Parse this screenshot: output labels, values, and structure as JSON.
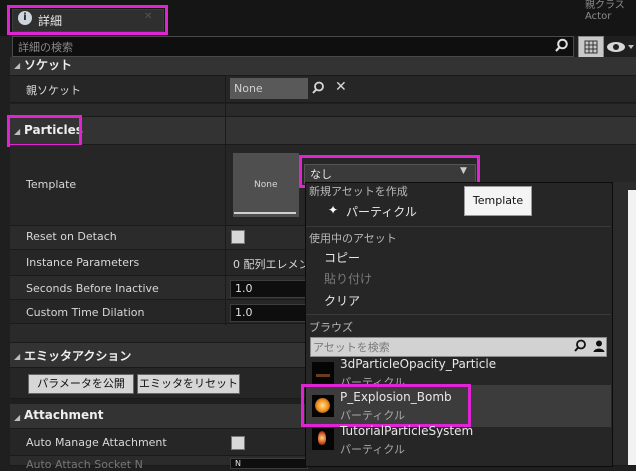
{
  "header": {
    "tab_title": "詳細",
    "top_right_text": "親クラス Actor"
  },
  "search": {
    "placeholder": "詳細の検索"
  },
  "categories": {
    "socket": "ソケット",
    "particles": "Particles",
    "emitter_actions": "エミッタアクション",
    "attachment": "Attachment"
  },
  "properties": {
    "parent_socket": {
      "label": "親ソケット",
      "value": "None"
    },
    "template": {
      "label": "Template",
      "thumb_label": "None",
      "dropdown_value": "なし"
    },
    "reset_on_detach": {
      "label": "Reset on Detach"
    },
    "instance_parameters": {
      "label": "Instance Parameters",
      "value": "0 配列エレメン"
    },
    "seconds_before_inactive": {
      "label": "Seconds Before Inactive",
      "value": "1.0"
    },
    "custom_time_dilation": {
      "label": "Custom Time Dilation",
      "value": "1.0"
    },
    "auto_manage_attachment": {
      "label": "Auto Manage Attachment"
    },
    "auto_attach_cutoff": {
      "label": "Auto Attach Socket N",
      "value": "N"
    }
  },
  "emitter_buttons": {
    "publish": "パラメータを公開",
    "reset": "エミッタをリセット"
  },
  "menu": {
    "create_header": "新規アセットを作成",
    "create_item": "パーティクル",
    "current_header": "使用中のアセット",
    "copy": "コピー",
    "paste": "貼り付け",
    "clear": "クリア",
    "browse_header": "ブラウズ",
    "search_placeholder": "アセットを検索",
    "assets": [
      {
        "name": "3dParticleOpacity_Particle",
        "type": "パーティクル"
      },
      {
        "name": "P_Explosion_Bomb",
        "type": "パーティクル"
      },
      {
        "name": "TutorialParticleSystem",
        "type": "パーティクル"
      }
    ]
  },
  "tooltip": {
    "text": "Template"
  },
  "colors": {
    "highlight": "#e024d4",
    "panel_bg": "#262626",
    "header_bg": "#151515"
  }
}
